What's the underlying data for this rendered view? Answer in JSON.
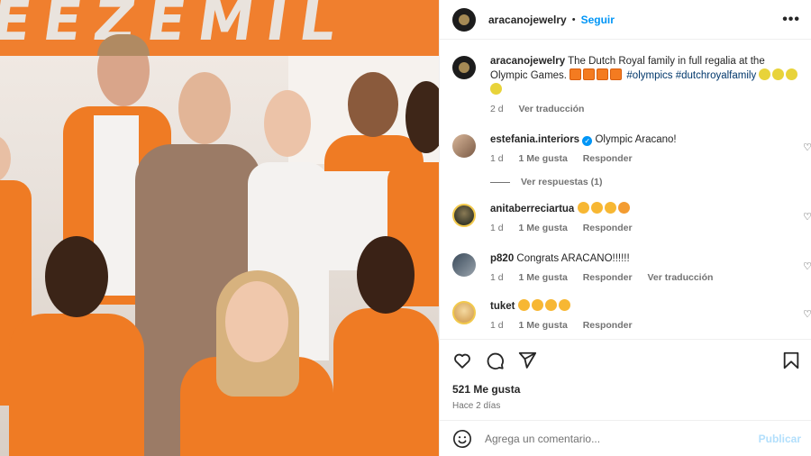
{
  "photo": {
    "banner_text": "EEZEMIL",
    "colors": {
      "orange": "#ef7b24",
      "banner": "#f07f2e",
      "background": "#efe8e2"
    }
  },
  "header": {
    "username": "aracanojewelry",
    "separator": "•",
    "follow_label": "Seguir",
    "more_icon": "more-horizontal-icon"
  },
  "caption": {
    "username": "aracanojewelry",
    "text": "The Dutch Royal family in full regalia at the Olympic Games.",
    "hashtags": "#olympics #dutchroyalfamily",
    "time": "2 d",
    "translate_label": "Ver traducción"
  },
  "comments": [
    {
      "username": "estefania.interiors",
      "verified": true,
      "text": "Olympic Aracano!",
      "time": "1 d",
      "likes": "1 Me gusta",
      "reply_label": "Responder",
      "view_replies": "Ver respuestas (1)"
    },
    {
      "username": "anitaberreciartua",
      "verified": false,
      "text": "",
      "time": "1 d",
      "likes": "1 Me gusta",
      "reply_label": "Responder"
    },
    {
      "username": "p820",
      "verified": false,
      "text": "Congrats ARACANO!!!!!!",
      "time": "1 d",
      "likes": "1 Me gusta",
      "reply_label": "Responder",
      "translate_label": "Ver traducción"
    },
    {
      "username": "tuket",
      "verified": false,
      "text": "",
      "time": "1 d",
      "likes": "1 Me gusta",
      "reply_label": "Responder"
    }
  ],
  "actions": {
    "like_icon": "heart-icon",
    "comment_icon": "comment-icon",
    "share_icon": "share-icon",
    "save_icon": "bookmark-icon",
    "likes": "521 Me gusta",
    "time": "Hace 2 días"
  },
  "comment_box": {
    "emoji_icon": "emoji-icon",
    "placeholder": "Agrega un comentario...",
    "publish_label": "Publicar"
  }
}
